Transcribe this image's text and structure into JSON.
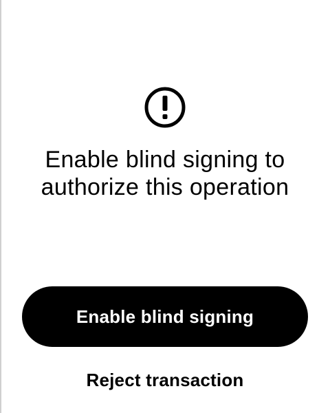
{
  "screen": {
    "icon": "exclamation-circle-icon",
    "message": "Enable blind signing to authorize this operation"
  },
  "actions": {
    "primary_label": "Enable blind signing",
    "secondary_label": "Reject transaction"
  },
  "colors": {
    "background": "#ffffff",
    "button_background": "#000000",
    "button_text": "#ffffff",
    "text": "#000000"
  }
}
